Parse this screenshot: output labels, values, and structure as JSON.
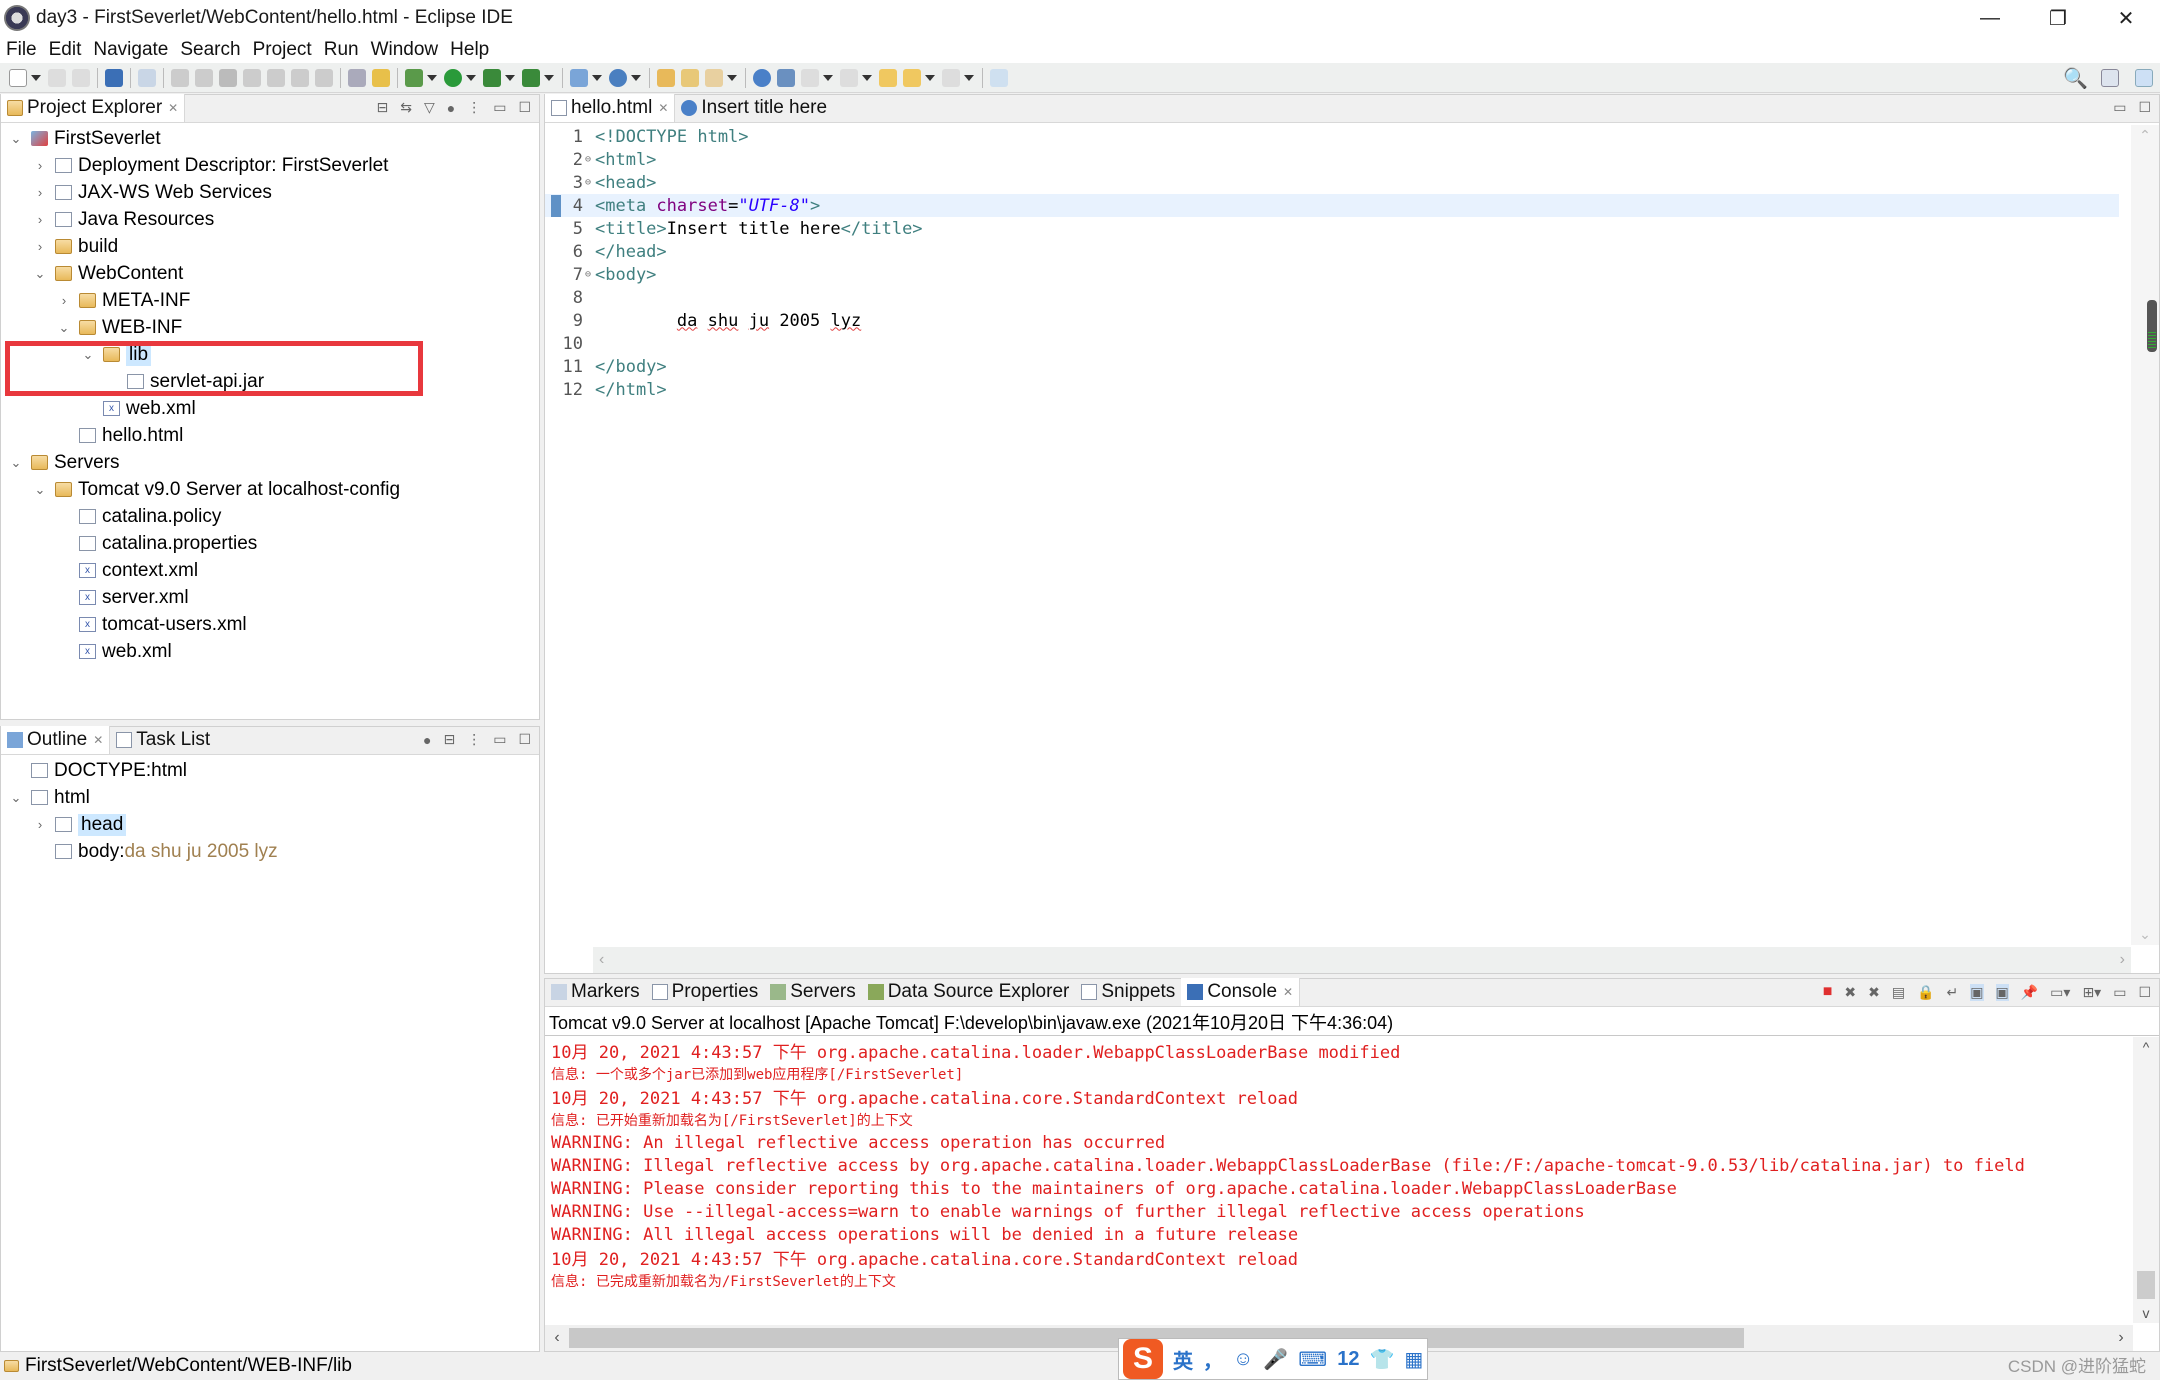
{
  "window": {
    "title": "day3 - FirstSeverlet/WebContent/hello.html - Eclipse IDE",
    "controls": {
      "minimize": "—",
      "restore": "❐",
      "close": "✕"
    }
  },
  "menu": [
    "File",
    "Edit",
    "Navigate",
    "Search",
    "Project",
    "Run",
    "Window",
    "Help"
  ],
  "project_explorer": {
    "tab_label": "Project Explorer",
    "items": [
      {
        "label": "FirstSeverlet",
        "depth": 0,
        "toggle": "v",
        "icon": "project-icon"
      },
      {
        "label": "Deployment Descriptor: FirstSeverlet",
        "depth": 1,
        "toggle": ">",
        "icon": "deployment-descriptor-icon"
      },
      {
        "label": "JAX-WS Web Services",
        "depth": 1,
        "toggle": ">",
        "icon": "web-services-icon"
      },
      {
        "label": "Java Resources",
        "depth": 1,
        "toggle": ">",
        "icon": "java-resources-icon"
      },
      {
        "label": "build",
        "depth": 1,
        "toggle": ">",
        "icon": "folder-icon"
      },
      {
        "label": "WebContent",
        "depth": 1,
        "toggle": "v",
        "icon": "folder-icon"
      },
      {
        "label": "META-INF",
        "depth": 2,
        "toggle": ">",
        "icon": "folder-icon"
      },
      {
        "label": "WEB-INF",
        "depth": 2,
        "toggle": "v",
        "icon": "folder-icon"
      },
      {
        "label": "lib",
        "depth": 3,
        "toggle": "v",
        "icon": "folder-icon",
        "selected": true
      },
      {
        "label": "servlet-api.jar",
        "depth": 4,
        "toggle": "",
        "icon": "jar-icon"
      },
      {
        "label": "web.xml",
        "depth": 3,
        "toggle": "",
        "icon": "xml-file-icon"
      },
      {
        "label": "hello.html",
        "depth": 2,
        "toggle": "",
        "icon": "html-file-icon"
      },
      {
        "label": "Servers",
        "depth": 0,
        "toggle": "v",
        "icon": "folder-icon"
      },
      {
        "label": "Tomcat v9.0 Server at localhost-config",
        "depth": 1,
        "toggle": "v",
        "icon": "folder-icon"
      },
      {
        "label": "catalina.policy",
        "depth": 2,
        "toggle": "",
        "icon": "file-icon"
      },
      {
        "label": "catalina.properties",
        "depth": 2,
        "toggle": "",
        "icon": "file-icon"
      },
      {
        "label": "context.xml",
        "depth": 2,
        "toggle": "",
        "icon": "xml-file-icon"
      },
      {
        "label": "server.xml",
        "depth": 2,
        "toggle": "",
        "icon": "xml-file-icon"
      },
      {
        "label": "tomcat-users.xml",
        "depth": 2,
        "toggle": "",
        "icon": "xml-file-icon"
      },
      {
        "label": "web.xml",
        "depth": 2,
        "toggle": "",
        "icon": "xml-file-icon"
      }
    ],
    "highlight_color": "#e8383d"
  },
  "outline": {
    "tabs": [
      "Outline",
      "Task List"
    ],
    "items": [
      {
        "label": "DOCTYPE:html",
        "depth": 0,
        "toggle": "",
        "icon": "doctype-icon"
      },
      {
        "label": "html",
        "depth": 0,
        "toggle": "v",
        "icon": "html-element-icon"
      },
      {
        "label": "head",
        "depth": 1,
        "toggle": ">",
        "icon": "element-icon",
        "selected": true
      },
      {
        "label": "body",
        "depth": 1,
        "toggle": "",
        "icon": "body-element-icon",
        "suffix": " : ",
        "detail": "da shu ju 2005 lyz"
      }
    ]
  },
  "editor": {
    "tabs": [
      {
        "label": "hello.html",
        "active": true
      },
      {
        "label": "Insert title here",
        "active": false
      }
    ],
    "current_line": 4,
    "lines": [
      {
        "n": "1",
        "fold": "",
        "parts": [
          [
            "tag",
            "<!DOCTYPE html>"
          ]
        ]
      },
      {
        "n": "2",
        "fold": "⊖",
        "parts": [
          [
            "tag",
            "<html>"
          ]
        ]
      },
      {
        "n": "3",
        "fold": "⊖",
        "parts": [
          [
            "tag",
            "<head>"
          ]
        ]
      },
      {
        "n": "4",
        "fold": "",
        "parts": [
          [
            "tag",
            "<meta "
          ],
          [
            "attr",
            "charset"
          ],
          [
            "txt",
            "="
          ],
          [
            "val",
            "\"UTF-8\""
          ],
          [
            "tag",
            ">"
          ]
        ]
      },
      {
        "n": "5",
        "fold": "",
        "parts": [
          [
            "tag",
            "<title>"
          ],
          [
            "txt",
            "Insert title here"
          ],
          [
            "tag",
            "</title>"
          ]
        ]
      },
      {
        "n": "6",
        "fold": "",
        "parts": [
          [
            "tag",
            "</head>"
          ]
        ]
      },
      {
        "n": "7",
        "fold": "⊖",
        "parts": [
          [
            "tag",
            "<body>"
          ]
        ]
      },
      {
        "n": "8",
        "fold": "",
        "parts": []
      },
      {
        "n": "9",
        "fold": "",
        "parts": [
          [
            "txt",
            "        "
          ],
          [
            "squig",
            "da"
          ],
          [
            "txt",
            " "
          ],
          [
            "squig",
            "shu"
          ],
          [
            "txt",
            " "
          ],
          [
            "squig",
            "ju"
          ],
          [
            "txt",
            " 2005 "
          ],
          [
            "squig",
            "lyz"
          ]
        ]
      },
      {
        "n": "10",
        "fold": "",
        "parts": []
      },
      {
        "n": "11",
        "fold": "",
        "parts": [
          [
            "tag",
            "</body>"
          ]
        ]
      },
      {
        "n": "12",
        "fold": "",
        "parts": [
          [
            "tag",
            "</html>"
          ]
        ]
      }
    ]
  },
  "bottom_panel": {
    "tabs": [
      "Markers",
      "Properties",
      "Servers",
      "Data Source Explorer",
      "Snippets",
      "Console"
    ],
    "active_tab": "Console",
    "console_header": "Tomcat v9.0 Server at localhost [Apache Tomcat] F:\\develop\\bin\\javaw.exe  (2021年10月20日 下午4:36:04)",
    "lines": [
      {
        "text": "10月 20, 2021 4:43:57 下午 org.apache.catalina.loader.WebappClassLoaderBase modified",
        "small": false
      },
      {
        "text": "信息: 一个或多个jar已添加到web应用程序[/FirstSeverlet]",
        "small": true
      },
      {
        "text": "10月 20, 2021 4:43:57 下午 org.apache.catalina.core.StandardContext reload",
        "small": false
      },
      {
        "text": "信息: 已开始重新加载名为[/FirstSeverlet]的上下文",
        "small": true
      },
      {
        "text": "WARNING: An illegal reflective access operation has occurred",
        "small": false
      },
      {
        "text": "WARNING: Illegal reflective access by org.apache.catalina.loader.WebappClassLoaderBase (file:/F:/apache-tomcat-9.0.53/lib/catalina.jar) to field",
        "small": false
      },
      {
        "text": "WARNING: Please consider reporting this to the maintainers of org.apache.catalina.loader.WebappClassLoaderBase",
        "small": false
      },
      {
        "text": "WARNING: Use --illegal-access=warn to enable warnings of further illegal reflective access operations",
        "small": false
      },
      {
        "text": "WARNING: All illegal access operations will be denied in a future release",
        "small": false
      },
      {
        "text": "10月 20, 2021 4:43:57 下午 org.apache.catalina.core.StandardContext reload",
        "small": false
      },
      {
        "text": "信息: 已完成重新加载名为/FirstSeverlet的上下文",
        "small": true
      }
    ],
    "error_color": "#e02020"
  },
  "status_bar": {
    "path": "FirstSeverlet/WebContent/WEB-INF/lib",
    "watermark": "CSDN @进阶猛蛇"
  },
  "ime": {
    "logo": "S",
    "items": [
      "英",
      "，",
      "☺",
      "🎤",
      "⌨",
      "12",
      "👕",
      "▦"
    ]
  }
}
